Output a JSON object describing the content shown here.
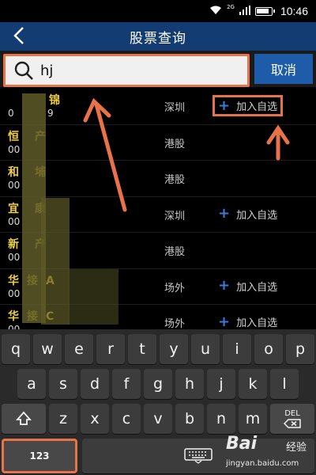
{
  "status": {
    "time": "10:46",
    "network": "2G"
  },
  "header": {
    "title": "股票查询"
  },
  "search": {
    "value": "hj",
    "cancel_label": "取消"
  },
  "results": [
    {
      "name": "锦",
      "code": "0",
      "code_tail": "9",
      "market": "深圳",
      "add_label": "加入自选",
      "highlight": true
    },
    {
      "name": "恒产",
      "code": "00",
      "market": "港股",
      "add_label": ""
    },
    {
      "name": "和埔",
      "code": "00",
      "market": "港股",
      "add_label": ""
    },
    {
      "name": "宜康",
      "code": "00",
      "market": "深圳",
      "add_label": "加入自选"
    },
    {
      "name": "新产",
      "code": "00",
      "market": "港股",
      "add_label": ""
    },
    {
      "name": "华接A",
      "code": "00",
      "market": "场外",
      "add_label": "加入自选"
    },
    {
      "name": "华接C",
      "code": "00",
      "market": "场外",
      "add_label": "加入自选"
    }
  ],
  "keyboard": {
    "row1": [
      "q",
      "w",
      "e",
      "r",
      "t",
      "y",
      "u",
      "i",
      "o",
      "p"
    ],
    "row2": [
      "a",
      "s",
      "d",
      "f",
      "g",
      "h",
      "j",
      "k",
      "l"
    ],
    "row3": [
      "z",
      "x",
      "c",
      "v",
      "b",
      "n",
      "m"
    ],
    "num_label": "123",
    "del_label": "DEL"
  },
  "watermark": {
    "logo": "Bai  ",
    "cn": "经验",
    "url": "jingyan.baidu.com"
  },
  "colors": {
    "header": "#123c72",
    "accent": "#e8734a",
    "cancel": "#1e5ba8",
    "stock_name": "#f0d040"
  }
}
